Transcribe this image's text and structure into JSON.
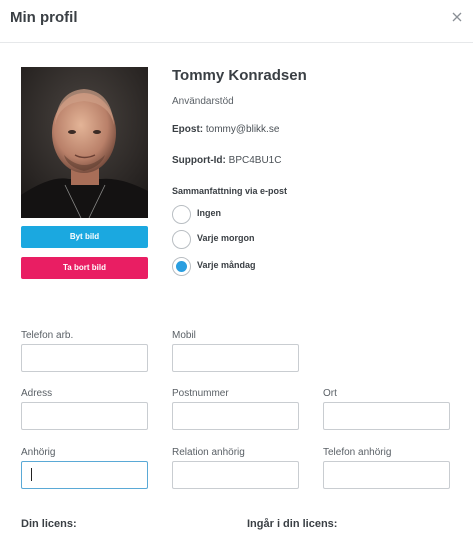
{
  "header": {
    "title": "Min profil",
    "close_icon": "close-icon"
  },
  "profile": {
    "name": "Tommy Konradsen",
    "role": "Användarstöd",
    "email_label": "Epost:",
    "email_value": "tommy@blikk.se",
    "support_label": "Support-Id:",
    "support_value": "BPC4BU1C",
    "photo_alt": "profile-photo"
  },
  "buttons": {
    "change_photo": "Byt bild",
    "remove_photo": "Ta bort bild"
  },
  "summary": {
    "label": "Sammanfattning via e-post",
    "options": [
      {
        "label": "Ingen",
        "selected": false
      },
      {
        "label": "Varje morgon",
        "selected": false
      },
      {
        "label": "Varje måndag",
        "selected": true
      }
    ]
  },
  "fields": {
    "phone_work": {
      "label": "Telefon arb.",
      "value": ""
    },
    "mobile": {
      "label": "Mobil",
      "value": ""
    },
    "address": {
      "label": "Adress",
      "value": ""
    },
    "postal_code": {
      "label": "Postnummer",
      "value": ""
    },
    "city": {
      "label": "Ort",
      "value": ""
    },
    "relative": {
      "label": "Anhörig",
      "value": ""
    },
    "relative_relation": {
      "label": "Relation anhörig",
      "value": ""
    },
    "relative_phone": {
      "label": "Telefon anhörig",
      "value": ""
    }
  },
  "license": {
    "your_license": "Din licens:",
    "included": "Ingår i din licens:"
  },
  "colors": {
    "primary_button": "#1ba8e0",
    "danger_button": "#e91e63",
    "radio_selected": "#2a9ee0"
  }
}
